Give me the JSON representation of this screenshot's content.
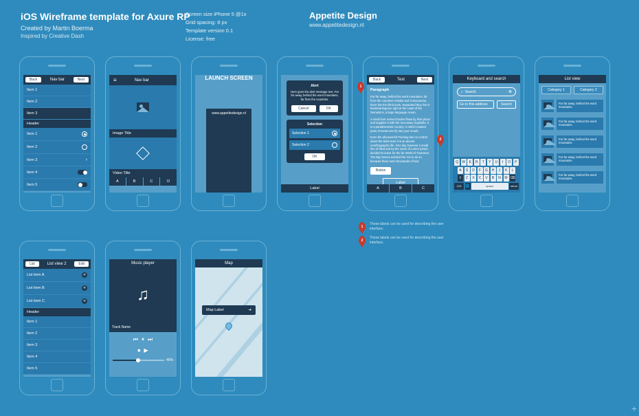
{
  "header": {
    "title": "iOS Wireframe template for Axure RP",
    "created_by": "Created by Martin Boerma",
    "inspired_by": "Inspired by Creative Dash"
  },
  "meta": {
    "screen": "Screen size iPhone 5 @1x",
    "grid": "Grid spacing: 8 px",
    "version": "Template version 0.1",
    "license": "License: free"
  },
  "brand": {
    "name": "Appetite Design",
    "url": "www.appetitedesign.nl"
  },
  "p1": {
    "nav": {
      "back": "Back",
      "title": "Nav bar",
      "next": "Next"
    },
    "items": [
      "Item 1",
      "Item 2",
      "Item 3"
    ],
    "header2": "Header",
    "rows": [
      "Item 1",
      "Item 2",
      "Item 3",
      "Item 4",
      "Item 5"
    ]
  },
  "p2": {
    "nav_title": "Nav bar",
    "img_title": "Image Title",
    "vid_title": "Video Title",
    "sections": [
      "A",
      "B",
      "C",
      "D"
    ]
  },
  "p3": {
    "title": "LAUNCH SCREEN",
    "url": "www.appetitedesign.nl"
  },
  "p4": {
    "alert_title": "Alert",
    "alert_text": "Here goes the alert message text. Far far away, behind the word mountains, far from the countries.",
    "cancel": "Cancel",
    "ok": "OK",
    "sel_title": "Selection",
    "sel1": "Selection 1",
    "sel2": "Selection 2",
    "label": "Label"
  },
  "p5": {
    "back": "Back",
    "title": "Text",
    "next": "Next",
    "heading": "Paragraph",
    "t1": "Far far away, behind the word mountains, far from the countries Vokalia and Consonantia, there live the blind texts. Separated they live in Bookmarksgrove right at the coast of the Semantics, a large language ocean.",
    "t2": "A small river named Duden flows by their place and supplies it with the necessary regelialia. It is a paradisematic country, in which roasted parts of sentences fly into your mouth.",
    "t3": "Even the all-powerful Pointing has no control about the blind texts it is an almost unorthographic life. One day however a small line of blind text by the name of Lorem Ipsum decided to leave for the far World of Grammar. The Big Oxmox advised her not to do so, because there were thousands of bad.",
    "btn": "Button",
    "label": "Label",
    "sections": [
      "A",
      "B",
      "C"
    ]
  },
  "p6": {
    "title": "Keyboard and search",
    "search_ph": "Search",
    "field_ph": "Go to this address",
    "go": "Search",
    "rows": [
      "Q",
      "W",
      "E",
      "R",
      "T",
      "Y",
      "U",
      "I",
      "O",
      "P"
    ],
    "rows2": [
      "A",
      "S",
      "D",
      "F",
      "G",
      "H",
      "J",
      "K",
      "L"
    ],
    "rows3": [
      "Z",
      "X",
      "C",
      "V",
      "B",
      "N",
      "M"
    ],
    "shift": "⇧",
    "del": "⌫",
    "num": "123",
    "globe": "🌐",
    "space": "space",
    "ret": "return"
  },
  "p7": {
    "title": "List view",
    "cat1": "Category 1",
    "cat2": "Category 2",
    "item_text": "Far far away, behind the word mountains."
  },
  "p8": {
    "list": "List",
    "title": "List view 2",
    "edit": "Edit",
    "items": [
      "List item A",
      "List item B",
      "List item C"
    ],
    "header2": "Header",
    "rows": [
      "Item 1",
      "Item 2",
      "Item 3",
      "Item 4",
      "Item 5"
    ]
  },
  "p9": {
    "title": "Music player",
    "track": "Track Name",
    "pct": "45%",
    "prev": "⏮",
    "play": "⏸",
    "stop": "⏹",
    "next": "⏭"
  },
  "p10": {
    "title": "Map",
    "label": "Map Label"
  },
  "notes": {
    "n1": "These labels can be used for describing the user interface.",
    "n2": "These labels can be used for describing the user interface."
  }
}
